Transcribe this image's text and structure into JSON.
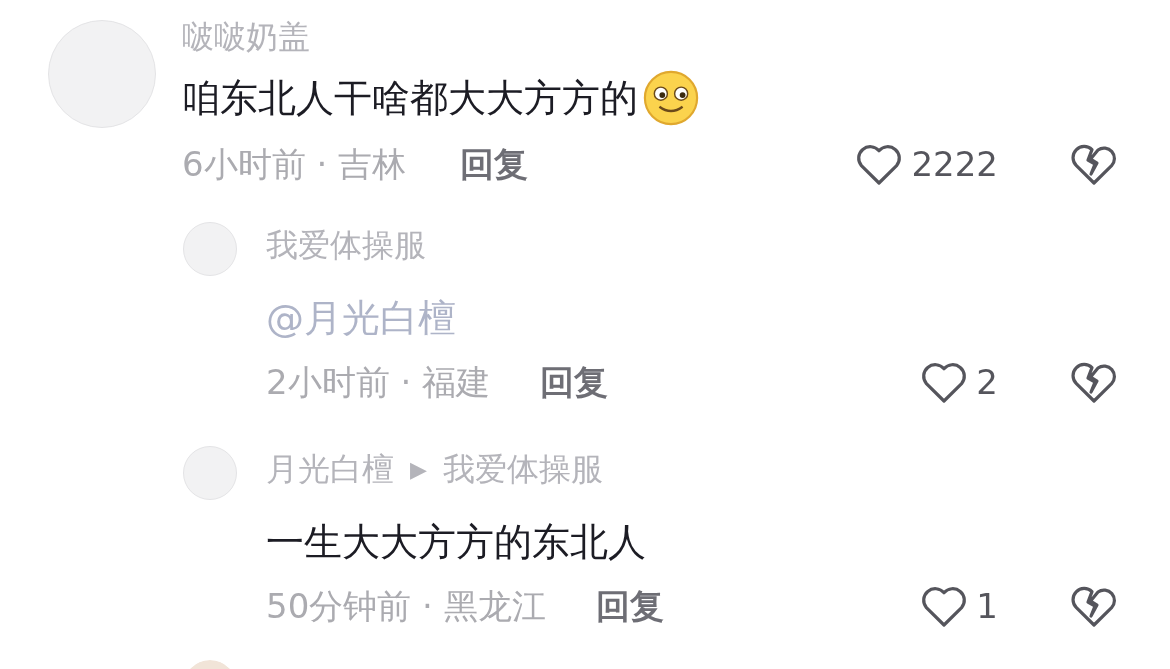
{
  "comments": [
    {
      "user": "啵啵奶盖",
      "text": "咱东北人干啥都大大方方的",
      "emoji": true,
      "time_location": "6小时前 · 吉林",
      "reply": "回复",
      "likes": "2222",
      "replies": [
        {
          "user": "我爱体操服",
          "text": "@月光白檀",
          "emoji": false,
          "time_location": "2小时前 · 福建",
          "reply": "回复",
          "likes": "2"
        },
        {
          "user": "月光白檀",
          "separator": "▶",
          "reply_to": "我爱体操服",
          "text": "一生大大方方的东北人",
          "emoji": false,
          "time_location": "50分钟前 · 黑龙江",
          "reply": "回复",
          "likes": "1"
        }
      ]
    }
  ]
}
